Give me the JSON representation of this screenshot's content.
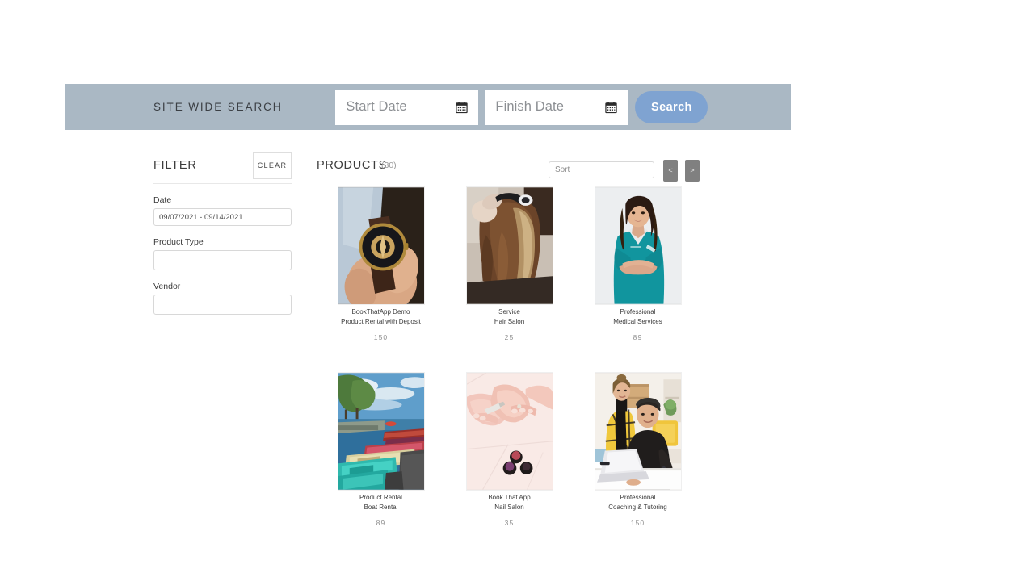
{
  "search": {
    "title": "SITE WIDE SEARCH",
    "start_date_placeholder": "Start Date",
    "finish_date_placeholder": "Finish Date",
    "start_date_value": "",
    "finish_date_value": "",
    "search_button": "Search",
    "bar_color": "#aab8c4",
    "button_color": "#7fa3d1"
  },
  "filter": {
    "title": "FILTER",
    "clear_label": "CLEAR",
    "fields": [
      {
        "label": "Date",
        "value": "09/07/2021 - 09/14/2021",
        "placeholder": ""
      },
      {
        "label": "Product Type",
        "value": "",
        "placeholder": ""
      },
      {
        "label": "Vendor",
        "value": "",
        "placeholder": ""
      }
    ]
  },
  "products": {
    "title": "PRODUCTS",
    "count": "(30)",
    "sort_placeholder": "Sort",
    "sort_value": "",
    "prev_label": "<",
    "next_label": ">",
    "items": [
      {
        "vendor": "BookThatApp Demo",
        "name": "Product Rental with Deposit",
        "price": "150",
        "image": "wristwatch-in-hand"
      },
      {
        "vendor": "Service",
        "name": "Hair Salon",
        "price": "25",
        "image": "hair-styling"
      },
      {
        "vendor": "Professional",
        "name": "Medical Services",
        "price": "89",
        "image": "medical-professional-teal-scrubs"
      },
      {
        "vendor": "Product Rental",
        "name": "Boat Rental",
        "price": "89",
        "image": "boats-at-dock"
      },
      {
        "vendor": "Book That App",
        "name": "Nail Salon",
        "price": "35",
        "image": "manicure-hands"
      },
      {
        "vendor": "Professional",
        "name": "Coaching & Tutoring",
        "price": "150",
        "image": "coaching-two-people-laptop"
      }
    ]
  }
}
